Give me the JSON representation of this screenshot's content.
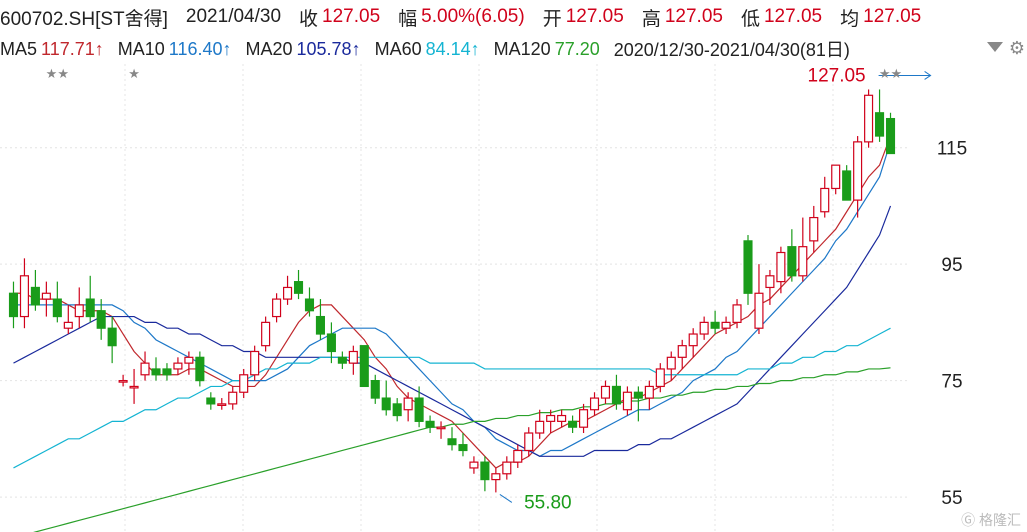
{
  "header": {
    "code": "600702.SH[ST舍得]",
    "date": "2021/04/30",
    "close_label": "收",
    "close": "127.05",
    "change_label": "幅",
    "change": "5.00%(6.05)",
    "open_label": "开",
    "open": "127.05",
    "high_label": "高",
    "high": "127.05",
    "low_label": "低",
    "low": "127.05",
    "avg_label": "均",
    "avg": "127.05"
  },
  "ma_bar": {
    "ma5_label": "MA5",
    "ma5": "117.71↑",
    "ma10_label": "MA10",
    "ma10": "116.40↑",
    "ma20_label": "MA20",
    "ma20": "105.78↑",
    "ma60_label": "MA60",
    "ma60": "84.14↑",
    "ma120_label": "MA120",
    "ma120": "77.20",
    "range": "2020/12/30-2021/04/30(81日)"
  },
  "colors": {
    "up": "#d0021b",
    "down": "#1a9c1a",
    "ma5": "#c0282d",
    "ma10": "#1e78c8",
    "ma20": "#1a2a9c",
    "ma60": "#14b4d2",
    "ma120": "#2aa02a",
    "ma250": "#a020c8"
  },
  "icons": {
    "dropdown": "chevron-down-icon",
    "settings": "gear-icon",
    "watermark": "格隆汇"
  },
  "chart_data": {
    "type": "candlestick",
    "ylim": [
      49,
      128
    ],
    "y_ticks": [
      "55",
      "75",
      "95",
      "115"
    ],
    "max_label": "127.05",
    "min_label": "55.80",
    "stars": [
      {
        "index": 4,
        "text": "★★"
      },
      {
        "index": 11,
        "text": "★"
      },
      {
        "index": 80,
        "text": "★★"
      }
    ],
    "ohlc": [
      [
        90,
        92,
        84,
        86
      ],
      [
        86,
        96,
        84,
        93
      ],
      [
        91,
        94,
        87,
        88
      ],
      [
        89,
        92,
        86,
        90
      ],
      [
        89,
        92,
        85,
        86
      ],
      [
        84,
        88,
        83,
        85
      ],
      [
        86,
        91,
        84,
        88
      ],
      [
        89,
        93,
        85,
        86
      ],
      [
        87,
        89,
        82,
        84
      ],
      [
        84,
        86,
        78,
        81
      ],
      [
        75,
        76,
        74,
        75
      ],
      [
        74,
        77,
        71,
        74
      ],
      [
        76,
        80,
        75,
        78
      ],
      [
        77,
        79,
        75,
        76
      ],
      [
        77,
        78,
        75,
        76
      ],
      [
        77,
        79,
        76,
        78
      ],
      [
        78,
        80,
        76,
        79
      ],
      [
        79,
        80,
        74,
        75
      ],
      [
        72,
        73,
        70,
        71
      ],
      [
        71,
        72,
        70,
        71
      ],
      [
        71,
        74,
        70,
        73
      ],
      [
        73,
        77,
        72,
        76
      ],
      [
        76,
        81,
        75,
        80
      ],
      [
        81,
        86,
        80,
        85
      ],
      [
        86,
        90,
        85,
        89
      ],
      [
        89,
        93,
        88,
        91
      ],
      [
        92,
        94,
        89,
        90
      ],
      [
        89,
        91,
        86,
        87
      ],
      [
        86,
        89,
        82,
        83
      ],
      [
        83,
        85,
        78,
        80
      ],
      [
        79,
        80,
        77,
        78
      ],
      [
        78,
        81,
        76,
        80
      ],
      [
        81,
        81,
        74,
        74
      ],
      [
        75,
        76,
        71,
        72
      ],
      [
        72,
        75,
        69,
        70
      ],
      [
        71,
        72,
        68,
        69
      ],
      [
        70,
        73,
        68,
        72
      ],
      [
        72,
        74,
        67,
        68
      ],
      [
        68,
        69,
        66,
        67
      ],
      [
        67,
        68,
        65,
        67
      ],
      [
        65,
        67,
        63,
        64
      ],
      [
        64,
        66,
        62,
        63
      ],
      [
        60,
        62,
        59,
        61
      ],
      [
        61,
        62,
        56,
        58
      ],
      [
        58,
        60,
        55.8,
        59
      ],
      [
        59,
        62,
        58,
        61
      ],
      [
        61,
        64,
        60,
        63
      ],
      [
        63,
        67,
        62,
        66
      ],
      [
        66,
        70,
        65,
        68
      ],
      [
        68,
        70,
        66,
        69
      ],
      [
        68,
        70,
        67,
        69
      ],
      [
        68,
        69,
        66,
        67
      ],
      [
        67,
        71,
        66,
        70
      ],
      [
        70,
        73,
        69,
        72
      ],
      [
        72,
        75,
        71,
        74
      ],
      [
        74,
        76,
        70,
        71
      ],
      [
        70,
        74,
        69,
        73
      ],
      [
        73,
        74,
        68,
        72
      ],
      [
        72,
        75,
        70,
        74
      ],
      [
        74,
        78,
        73,
        77
      ],
      [
        77,
        80,
        75,
        79
      ],
      [
        79,
        82,
        77,
        81
      ],
      [
        81,
        84,
        79,
        83
      ],
      [
        83,
        86,
        82,
        85
      ],
      [
        85,
        87,
        83,
        84
      ],
      [
        84,
        86,
        83,
        85
      ],
      [
        85,
        89,
        84,
        88
      ],
      [
        99,
        100,
        88,
        90
      ],
      [
        84,
        95,
        83,
        90
      ],
      [
        91,
        94,
        88,
        93
      ],
      [
        92,
        98,
        90,
        97
      ],
      [
        98,
        101,
        92,
        93
      ],
      [
        93,
        103,
        92,
        98
      ],
      [
        99,
        105,
        97,
        103
      ],
      [
        104,
        110,
        103,
        108
      ],
      [
        108,
        112,
        107,
        112
      ],
      [
        111,
        112,
        106,
        106
      ],
      [
        106,
        117,
        103,
        116
      ],
      [
        116,
        125,
        115,
        124
      ],
      [
        121,
        125,
        116,
        117
      ],
      [
        120,
        121,
        114,
        114
      ]
    ],
    "ma_series": [
      {
        "name": "MA5",
        "values": [
          90,
          90,
          89,
          89,
          89,
          88,
          87,
          87,
          87,
          86,
          83,
          80,
          78,
          76,
          76,
          76,
          77,
          77,
          76,
          75,
          74,
          74,
          74,
          76,
          79,
          82,
          85,
          87,
          88,
          88,
          86,
          84,
          82,
          79,
          77,
          74,
          72,
          71,
          70,
          69,
          68,
          66,
          64,
          62,
          60,
          61,
          61,
          62,
          64,
          66,
          67,
          68,
          68,
          69,
          70,
          71,
          72,
          72,
          73,
          74,
          75,
          77,
          79,
          81,
          83,
          84,
          85,
          86,
          88,
          89,
          91,
          93,
          95,
          97,
          99,
          101,
          104,
          107,
          110,
          112,
          117
        ]
      },
      {
        "name": "MA10",
        "values": [
          88,
          88,
          88,
          88,
          88,
          88,
          88,
          88,
          88,
          88,
          87,
          85,
          84,
          82,
          81,
          80,
          79,
          78,
          77,
          76,
          75,
          75,
          75,
          75,
          76,
          77,
          79,
          81,
          82,
          83,
          84,
          84,
          84,
          84,
          83,
          81,
          79,
          77,
          75,
          73,
          71,
          70,
          68,
          67,
          65,
          64,
          63,
          63,
          62,
          63,
          63,
          64,
          65,
          66,
          67,
          68,
          69,
          70,
          70,
          71,
          72,
          73,
          75,
          76,
          77,
          79,
          80,
          82,
          84,
          86,
          88,
          90,
          92,
          94,
          96,
          99,
          101,
          104,
          107,
          110,
          116
        ]
      },
      {
        "name": "MA20",
        "values": [
          78,
          79,
          80,
          81,
          82,
          83,
          84,
          85,
          86,
          86,
          86,
          86,
          85,
          85,
          84,
          84,
          83,
          83,
          82,
          81,
          81,
          80,
          80,
          79,
          79,
          79,
          79,
          79,
          79,
          79,
          79,
          78,
          78,
          77,
          76,
          75,
          74,
          73,
          72,
          71,
          70,
          69,
          68,
          67,
          66,
          65,
          64,
          63,
          62,
          62,
          62,
          62,
          62,
          63,
          63,
          63,
          63,
          64,
          64,
          65,
          65,
          66,
          67,
          68,
          69,
          70,
          71,
          73,
          75,
          77,
          79,
          81,
          83,
          85,
          87,
          89,
          91,
          94,
          97,
          100,
          105
        ]
      },
      {
        "name": "MA60",
        "values": [
          60,
          61,
          62,
          63,
          64,
          65,
          65,
          66,
          67,
          68,
          68,
          69,
          70,
          70,
          71,
          72,
          72,
          73,
          74,
          74,
          75,
          75,
          76,
          77,
          77,
          78,
          78,
          78,
          79,
          79,
          79,
          79,
          79,
          79,
          79,
          79,
          79,
          79,
          78,
          78,
          78,
          78,
          78,
          77,
          77,
          77,
          77,
          77,
          77,
          77,
          77,
          77,
          77,
          77,
          77,
          77,
          77,
          77,
          77,
          76,
          76,
          76,
          76,
          76,
          76,
          76,
          76,
          77,
          77,
          77,
          78,
          78,
          79,
          79,
          80,
          80,
          81,
          81,
          82,
          83,
          84
        ]
      },
      {
        "name": "MA120",
        "values": [
          48,
          48.5,
          49,
          49.5,
          50,
          50.5,
          51,
          51.5,
          52,
          52.5,
          53,
          53.5,
          54,
          54.5,
          55,
          55.5,
          56,
          56.5,
          57,
          57.5,
          58,
          58.5,
          59,
          59.5,
          60,
          60.5,
          61,
          61.5,
          62,
          62.5,
          63,
          63.5,
          64,
          64.5,
          65,
          65.5,
          66,
          66.5,
          67,
          67,
          67.5,
          67.5,
          68,
          68,
          68.5,
          68.5,
          69,
          69,
          69.5,
          69.5,
          70,
          70,
          70.5,
          70.5,
          71,
          71,
          71.5,
          71.5,
          72,
          72,
          72.5,
          72.5,
          73,
          73,
          73.5,
          73.5,
          74,
          74,
          74.5,
          74.5,
          75,
          75,
          75.5,
          75.5,
          76,
          76,
          76.5,
          76.5,
          77,
          77,
          77.2
        ]
      }
    ]
  }
}
